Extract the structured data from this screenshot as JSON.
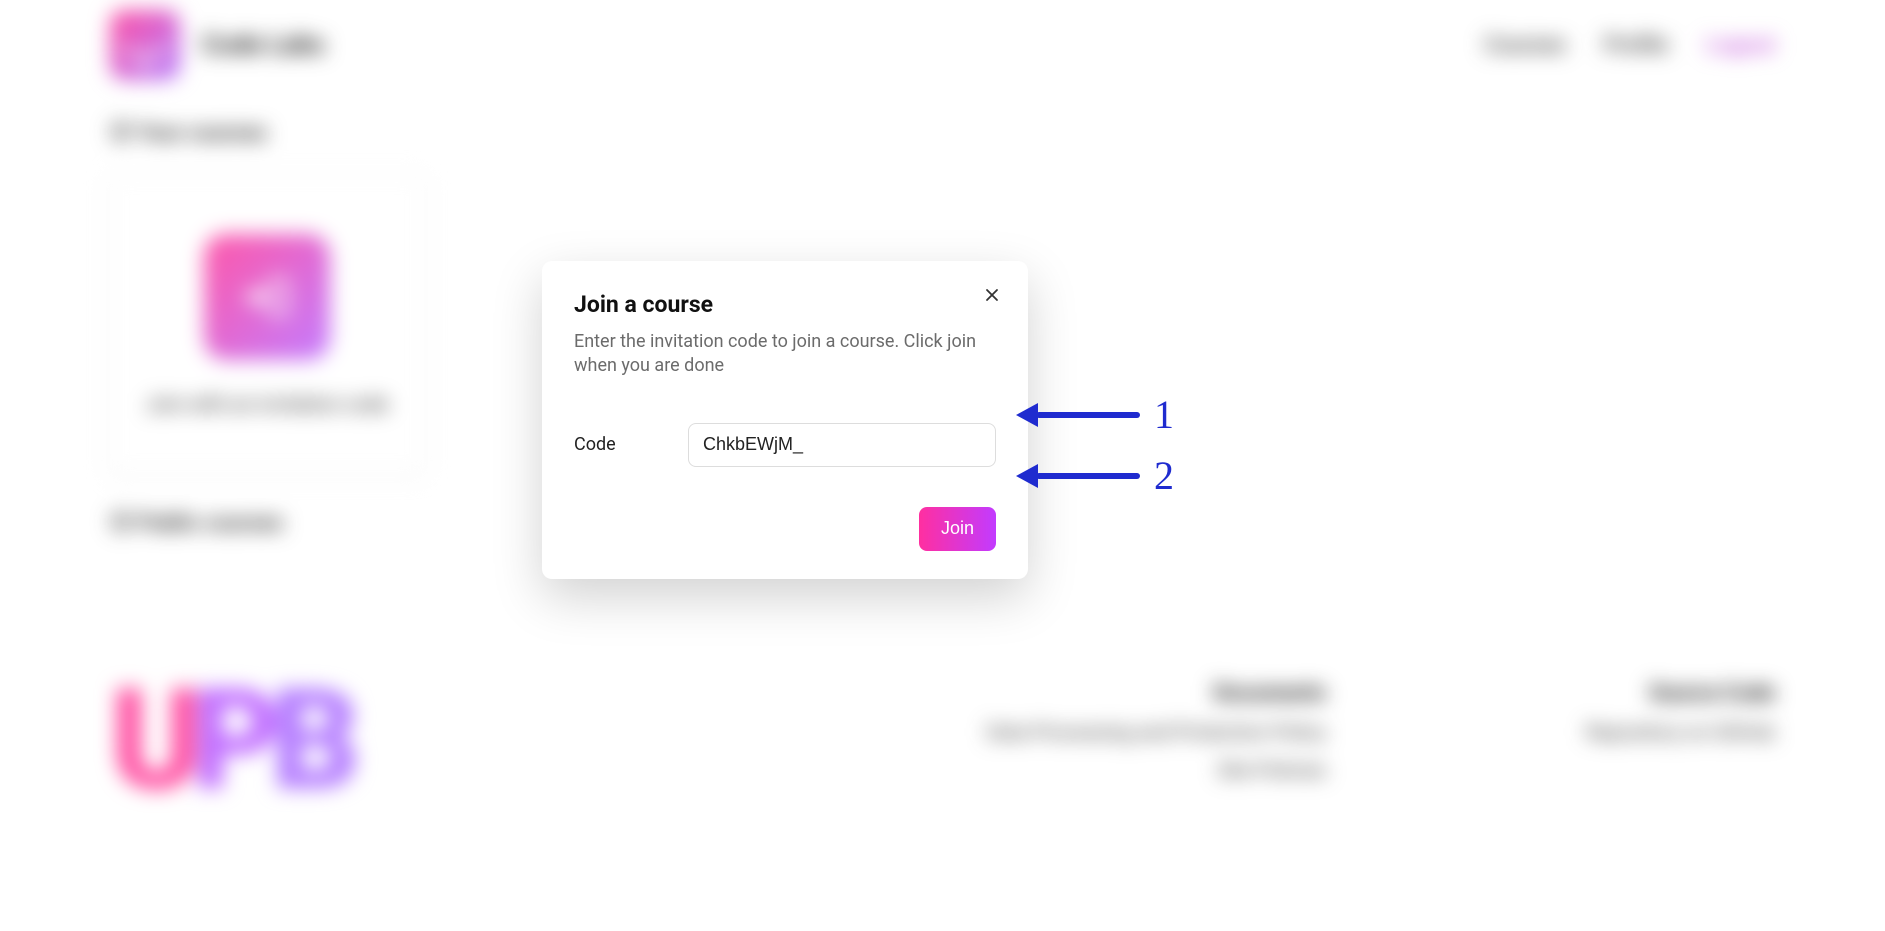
{
  "header": {
    "brand": "Code Labs",
    "nav": [
      "Courses",
      "Profile",
      "Logout"
    ]
  },
  "sections": {
    "your_courses_prefix": "⦿",
    "your_courses": "Your courses",
    "public_courses_prefix": "⦿",
    "public_courses": "Public courses"
  },
  "card": {
    "label": "Join with an invitation code"
  },
  "footer": {
    "col1": {
      "title": "Documents",
      "links": [
        "Data Processing and Protection Policy",
        "Site Policies"
      ]
    },
    "col2": {
      "title": "Source Code",
      "links": [
        "Repository on GitHub"
      ]
    }
  },
  "modal": {
    "title": "Join a course",
    "description": "Enter the invitation code to join a course. Click join when you are done",
    "code_label": "Code",
    "code_value": "ChkbEWjM_",
    "join_label": "Join"
  },
  "annotations": [
    "1",
    "2"
  ],
  "colors": {
    "gradient_start": "#ff2fa0",
    "gradient_end": "#c23bff",
    "annotation": "#1f2bcf"
  }
}
